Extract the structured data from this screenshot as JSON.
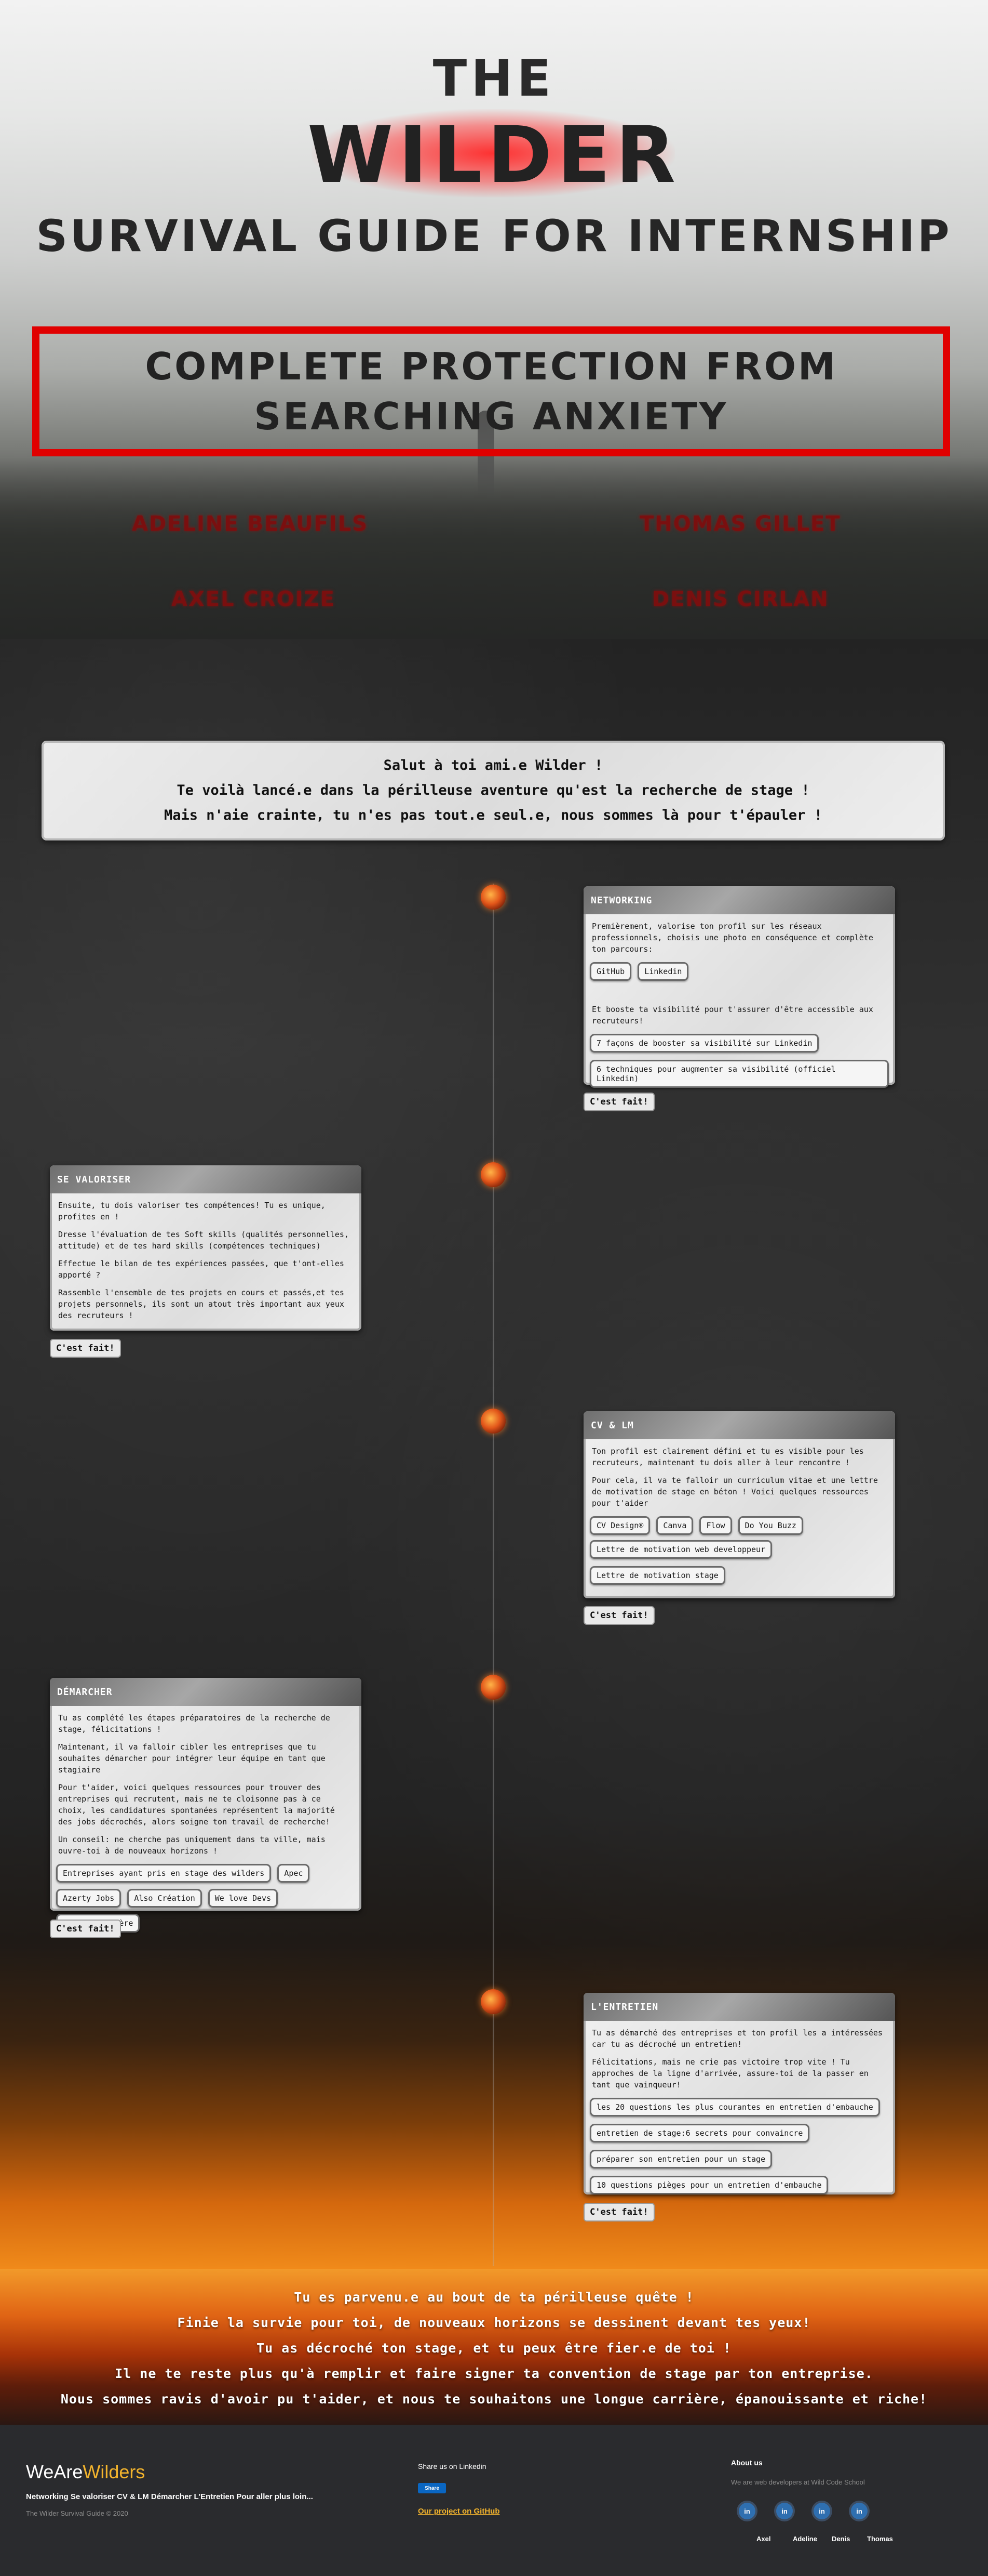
{
  "hero": {
    "the": "THE",
    "wilder": "WILDER",
    "subtitle": "SURVIVAL GUIDE FOR INTERNSHIP",
    "tagline": "COMPLETE PROTECTION FROM SEARCHING ANXIETY",
    "authors": [
      "ADELINE BEAUFILS",
      "THOMAS GILLET",
      "AXEL CROIZE",
      "DENIS CIRLAN"
    ],
    "colors": {
      "accent_red": "#e00000",
      "author_red": "#7a0f0f"
    }
  },
  "welcome": {
    "lines": [
      "Salut à toi ami.e Wilder !",
      "Te voilà lancé.e dans la périlleuse aventure qu'est la recherche de stage !",
      "Mais n'aie crainte, tu n'es pas tout.e seul.e, nous sommes là pour t'épauler !"
    ]
  },
  "steps": {
    "networking": {
      "title": "NETWORKING",
      "p1": "Premièrement, valorise ton profil sur les réseaux professionnels, choisis une photo en conséquence et complète ton parcours:",
      "links1": [
        "GitHub",
        "Linkedin"
      ],
      "p2": "Et booste ta visibilité pour t'assurer d'être accessible aux recruteurs!",
      "links2": [
        "7 façons de booster sa visibilité sur Linkedin",
        "6 techniques pour augmenter sa visibilité (officiel Linkedin)"
      ],
      "done": "C'est fait!"
    },
    "valoriser": {
      "title": "SE VALORISER",
      "p1": "Ensuite, tu dois valoriser tes compétences! Tu es unique, profites en !",
      "p2": "Dresse l'évaluation de tes Soft skills (qualités personnelles, attitude) et de tes hard skills (compétences techniques)",
      "p3": "Effectue le bilan de tes expériences passées, que t'ont-elles apporté ?",
      "p4": "Rassemble l'ensemble de tes projets en cours et passés,et tes projets personnels, ils sont un atout très important aux yeux des recruteurs !",
      "done": "C'est fait!"
    },
    "cvlm": {
      "title": "CV & LM",
      "p1": "Ton profil est clairement défini et tu es visible pour les recruteurs, maintenant tu dois aller à leur rencontre !",
      "p2": "Pour cela, il va te falloir un curriculum vitae et une lettre de motivation de stage en béton ! Voici quelques ressources pour t'aider",
      "links1": [
        "CV Design®",
        "Canva",
        "Flow",
        "Do You Buzz"
      ],
      "links2": [
        "Lettre de motivation web developpeur",
        "Lettre de motivation stage"
      ],
      "done": "C'est fait!"
    },
    "demarcher": {
      "title": "DÉMARCHER",
      "p1": "Tu as complété les étapes préparatoires de la recherche de stage, félicitations !",
      "p2": "Maintenant, il va falloir cibler les entreprises que tu souhaites démarcher pour intégrer leur équipe en tant que stagiaire",
      "p3": "Pour t'aider, voici quelques ressources pour trouver des entreprises qui recrutent, mais ne te cloisonne pas à ce choix, les candidatures spontanées représentent la majorité des jobs décrochés, alors soigne ton travail de recherche!",
      "p4": "Un conseil: ne cherche pas uniquement dans ta ville, mais ouvre-toi à de nouveaux horizons !",
      "links1": [
        "Entreprises ayant pris en stage des wilders",
        "Apec",
        "Azerty Jobs"
      ],
      "links2": [
        "Also Création",
        "We love Devs",
        "Option Carrière"
      ],
      "done": "C'est fait!"
    },
    "entretien": {
      "title": "L'ENTRETIEN",
      "p1": "Tu as démarché des entreprises et ton profil les a intéressées car tu as décroché un entretien!",
      "p2": "Félicitations, mais ne crie pas victoire trop vite ! Tu approches de la ligne d'arrivée, assure-toi de la passer en tant que vainqueur!",
      "links": [
        "les 20 questions les plus courantes en entretien d'embauche",
        "entretien de stage:6 secrets pour convaincre",
        "préparer son entretien pour un stage",
        "10 questions pièges pour un entretien d'embauche"
      ],
      "done": "C'est fait!"
    }
  },
  "finale": {
    "lines": [
      "Tu es parvenu.e au bout de ta périlleuse quête !",
      "Finie la survie pour toi, de nouveaux horizons se dessinent devant tes yeux!",
      "Tu as décroché ton stage, et tu peux être fier.e de toi !",
      "Il ne te reste plus qu'à remplir et faire signer ta convention de stage par ton entreprise.",
      "Nous sommes ravis d'avoir pu t'aider, et nous te souhaitons une longue carrière, épanouissante et riche!"
    ]
  },
  "footer": {
    "brand_a": "WeAre",
    "brand_b": "Wilders",
    "nav": "Networking Se valoriser CV & LM Démarcher L'Entretien Pour aller plus loin...",
    "copyright": "The Wilder Survival Guide © 2020",
    "share_label": "Share us on Linkedin",
    "share_button": "Share",
    "project_link": "Our project on GitHub",
    "about_title": "About us",
    "about_text": "We are web developers at Wild Code School",
    "team": [
      {
        "name": "Axel",
        "icon": "linkedin-icon"
      },
      {
        "name": "Adeline",
        "icon": "linkedin-icon"
      },
      {
        "name": "Denis",
        "icon": "linkedin-icon"
      },
      {
        "name": "Thomas",
        "icon": "linkedin-icon"
      }
    ],
    "colors": {
      "brand_yellow": "#f3b42d",
      "linkedin_blue": "#0a66c2"
    }
  }
}
